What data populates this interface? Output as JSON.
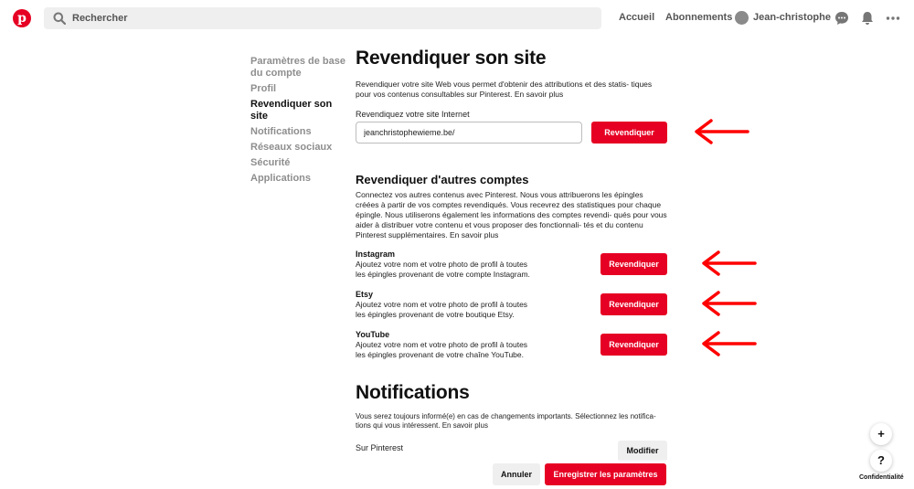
{
  "header": {
    "search_placeholder": "Rechercher",
    "nav_home": "Accueil",
    "nav_following": "Abonnements",
    "user_name": "Jean-christophe"
  },
  "sidebar": {
    "items": [
      {
        "label": "Paramètres de base du compte"
      },
      {
        "label": "Profil"
      },
      {
        "label": "Revendiquer son site"
      },
      {
        "label": "Notifications"
      },
      {
        "label": "Réseaux sociaux"
      },
      {
        "label": "Sécurité"
      },
      {
        "label": "Applications"
      }
    ]
  },
  "claim": {
    "title": "Revendiquer son site",
    "description": "Revendiquer votre site Web vous permet d'obtenir des attributions et des statis- tiques pour vos contenus consultables sur Pinterest. En savoir plus",
    "input_label": "Revendiquez votre site Internet",
    "input_value": "jeanchristophewieme.be/",
    "button": "Revendiquer"
  },
  "other_accounts": {
    "title": "Revendiquer d'autres comptes",
    "description": "Connectez vos autres contenus avec Pinterest. Nous vous attribuerons les épingles créées à partir de vos comptes revendiqués. Vous recevrez des statistiques pour chaque épingle. Nous utiliserons également les informations des comptes revendi- qués pour vous aider à distribuer votre contenu et vous proposer des fonctionnali- tés et du contenu Pinterest supplémentaires. En savoir plus",
    "accounts": [
      {
        "name": "Instagram",
        "line1": "Ajoutez votre nom et votre photo de profil à toutes",
        "line2": "les épingles provenant de votre compte Instagram.",
        "button": "Revendiquer"
      },
      {
        "name": "Etsy",
        "line1": "Ajoutez votre nom et votre photo de profil à toutes",
        "line2": "les épingles provenant de votre boutique Etsy.",
        "button": "Revendiquer"
      },
      {
        "name": "YouTube",
        "line1": "Ajoutez votre nom et votre photo de profil à toutes",
        "line2": "les épingles provenant de votre chaîne YouTube.",
        "button": "Revendiquer"
      }
    ]
  },
  "notifications": {
    "title": "Notifications",
    "description": "Vous serez toujours informé(e) en cas de changements importants. Sélectionnez les notifica- tions qui vous intéressent. En savoir plus",
    "on_pinterest": "Sur Pinterest",
    "modify": "Modifier"
  },
  "footer": {
    "cancel": "Annuler",
    "save": "Enregistrer les paramètres"
  },
  "floating": {
    "plus": "+",
    "help": "?",
    "privacy": "Confidentialité"
  },
  "colors": {
    "brand_red": "#e60023",
    "arrow_red": "#ff0000"
  }
}
